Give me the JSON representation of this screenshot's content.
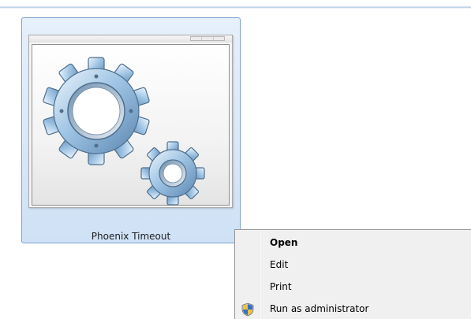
{
  "file_tile": {
    "label": "Phoenix Timeout",
    "icon": "gears-icon"
  },
  "context_menu": {
    "items": [
      {
        "label": "Open",
        "bold": true,
        "icon": ""
      },
      {
        "label": "Edit",
        "bold": false,
        "icon": ""
      },
      {
        "label": "Print",
        "bold": false,
        "icon": ""
      },
      {
        "label": "Run as administrator",
        "bold": false,
        "icon": "uac-shield-icon"
      }
    ]
  },
  "colors": {
    "selection_border": "#7da2ce",
    "selection_fill": "#d9e8f9",
    "menu_background": "#f0f0f0",
    "shield_blue": "#2f6fce",
    "shield_yellow": "#f2c232"
  }
}
